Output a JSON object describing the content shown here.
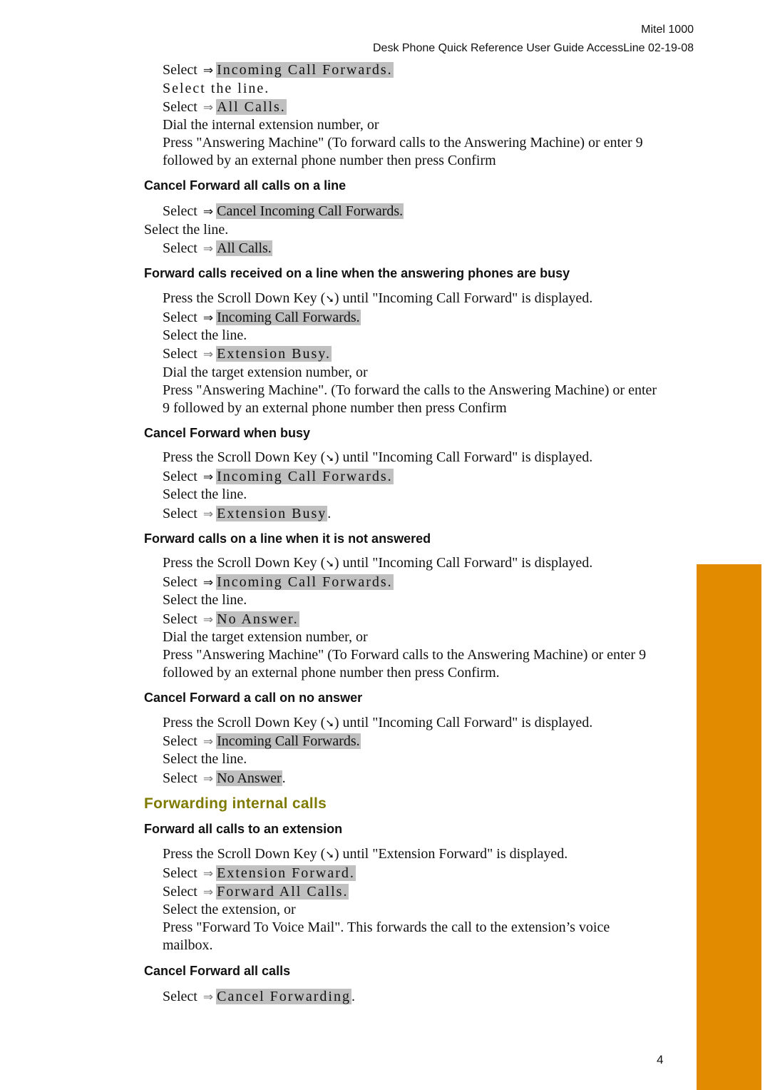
{
  "header": {
    "product": "Mitel 1000",
    "doc_title": "Desk Phone Quick Reference User Guide AccessLine 02-19-08"
  },
  "common": {
    "select": "Select",
    "select_line": "Select the line.",
    "select_line_spaced": "Select the line.",
    "scroll_prefix": "Press the Scroll Down Key (",
    "scroll_icon": "➘",
    "scroll_suffix_icf": ") until \"Incoming Call Forward\" is displayed.",
    "scroll_suffix_ef": ") until \"Extension Forward\" is displayed.",
    "arrow": "⇒"
  },
  "block1": {
    "opt1": "Incoming Call Forwards.",
    "opt2": "All Calls.",
    "dial": "Dial the internal extension number, or",
    "press1": "Press \"Answering Machine\" (To forward calls to the Answering Machine) or enter 9",
    "press2": "followed by an external phone number then press Confirm"
  },
  "cancel_all_line": {
    "heading": "Cancel Forward all calls on a line",
    "opt1": "Cancel Incoming Call Forwards.",
    "opt2": "All Calls."
  },
  "busy": {
    "heading": "Forward calls received on a line when the answering phones are busy",
    "opt1": "Incoming Call Forwards.",
    "opt2": "Extension Busy.",
    "dial": "Dial the target extension number, or",
    "press1": "Press \"Answering Machine\". (To forward the calls to the Answering Machine) or enter",
    "press2": "9 followed by an external phone number then press Confirm"
  },
  "cancel_busy": {
    "heading": "Cancel Forward when busy",
    "opt1": "Incoming Call Forwards.",
    "opt2": "Extension Busy",
    "tail": "."
  },
  "no_answer": {
    "heading": "Forward calls on a line when it is not answered",
    "opt1": "Incoming Call Forwards.",
    "opt2": "No Answer.",
    "dial": "Dial the target extension number, or",
    "press1": "Press \"Answering Machine\" (To Forward calls to the Answering Machine) or enter 9",
    "press2": "followed by an external phone number then press Confirm."
  },
  "cancel_no_answer": {
    "heading": "Cancel Forward a call on no answer",
    "opt1": "Incoming Call Forwards.",
    "opt2": "No Answer",
    "tail": "."
  },
  "internal": {
    "section_title": "Forwarding internal calls",
    "heading": "Forward all calls to an extension",
    "opt1": "Extension Forward.",
    "opt2": "Forward All Calls.",
    "select_ext": "Select the extension, or",
    "press1": "Press \"Forward To Voice Mail\". This forwards the call to the extension’s voice",
    "press2": "mailbox."
  },
  "cancel_all": {
    "heading": "Cancel Forward all calls",
    "opt1": "Cancel Forwarding",
    "tail": "."
  },
  "page_number": "4",
  "colors": {
    "tab": "#e38b00",
    "section_title": "#7f7a00",
    "highlight": "#c0c0c0"
  }
}
